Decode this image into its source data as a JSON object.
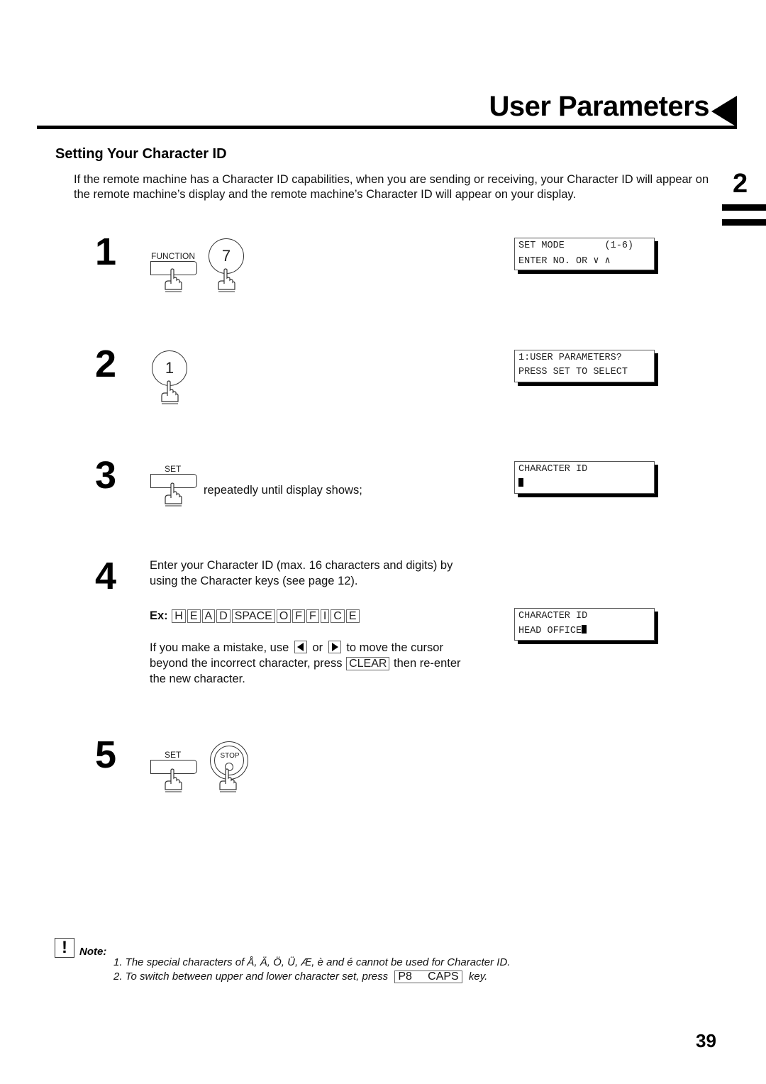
{
  "header": {
    "title": "User Parameters",
    "chapter_number": "2"
  },
  "section": {
    "title": "Setting Your Character ID",
    "intro": "If the remote machine has a Character ID capabilities, when you are sending or receiving, your Character ID will appear on the remote machine’s display and the remote machine’s Character ID will appear on your display."
  },
  "steps": [
    {
      "number": "1",
      "keys": {
        "function_label": "FUNCTION",
        "digit": "7"
      },
      "display": {
        "line1": "SET MODE       (1-6)",
        "line2": "ENTER NO. OR ∨ ∧"
      }
    },
    {
      "number": "2",
      "keys": {
        "digit": "1"
      },
      "display": {
        "line1": "1:USER PARAMETERS?",
        "line2": "PRESS SET TO SELECT"
      }
    },
    {
      "number": "3",
      "keys": {
        "set_label": "SET"
      },
      "instruction": "repeatedly until display shows;",
      "display": {
        "line1": "CHARACTER ID",
        "line2": ""
      }
    },
    {
      "number": "4",
      "instruction": "Enter your Character ID (max. 16 characters and digits) by using the Character keys (see page 12).",
      "example_label": "Ex:",
      "example_keys": [
        "H",
        "E",
        "A",
        "D",
        "SPACE",
        "O",
        "F",
        "F",
        "I",
        "C",
        "E"
      ],
      "mistake_text": {
        "part1": "If you make a mistake, use",
        "or": "or",
        "part2": "to move the cursor beyond the incorrect character, press",
        "clear_key": "CLEAR",
        "part3": "then re-enter the new character."
      },
      "display": {
        "line1": "CHARACTER ID",
        "line2": "HEAD OFFICE"
      }
    },
    {
      "number": "5",
      "keys": {
        "set_label": "SET",
        "stop_label": "STOP"
      }
    }
  ],
  "note": {
    "label": "Note:",
    "items": [
      "1.  The special characters of Å, Ä, Ö, Ü, Æ, è and é cannot be used for Character ID.",
      "2.  To switch between upper and lower character set, press"
    ],
    "key_p8": "P8",
    "key_caps": "CAPS",
    "key_suffix": "key."
  },
  "footer": {
    "page_number": "39"
  }
}
